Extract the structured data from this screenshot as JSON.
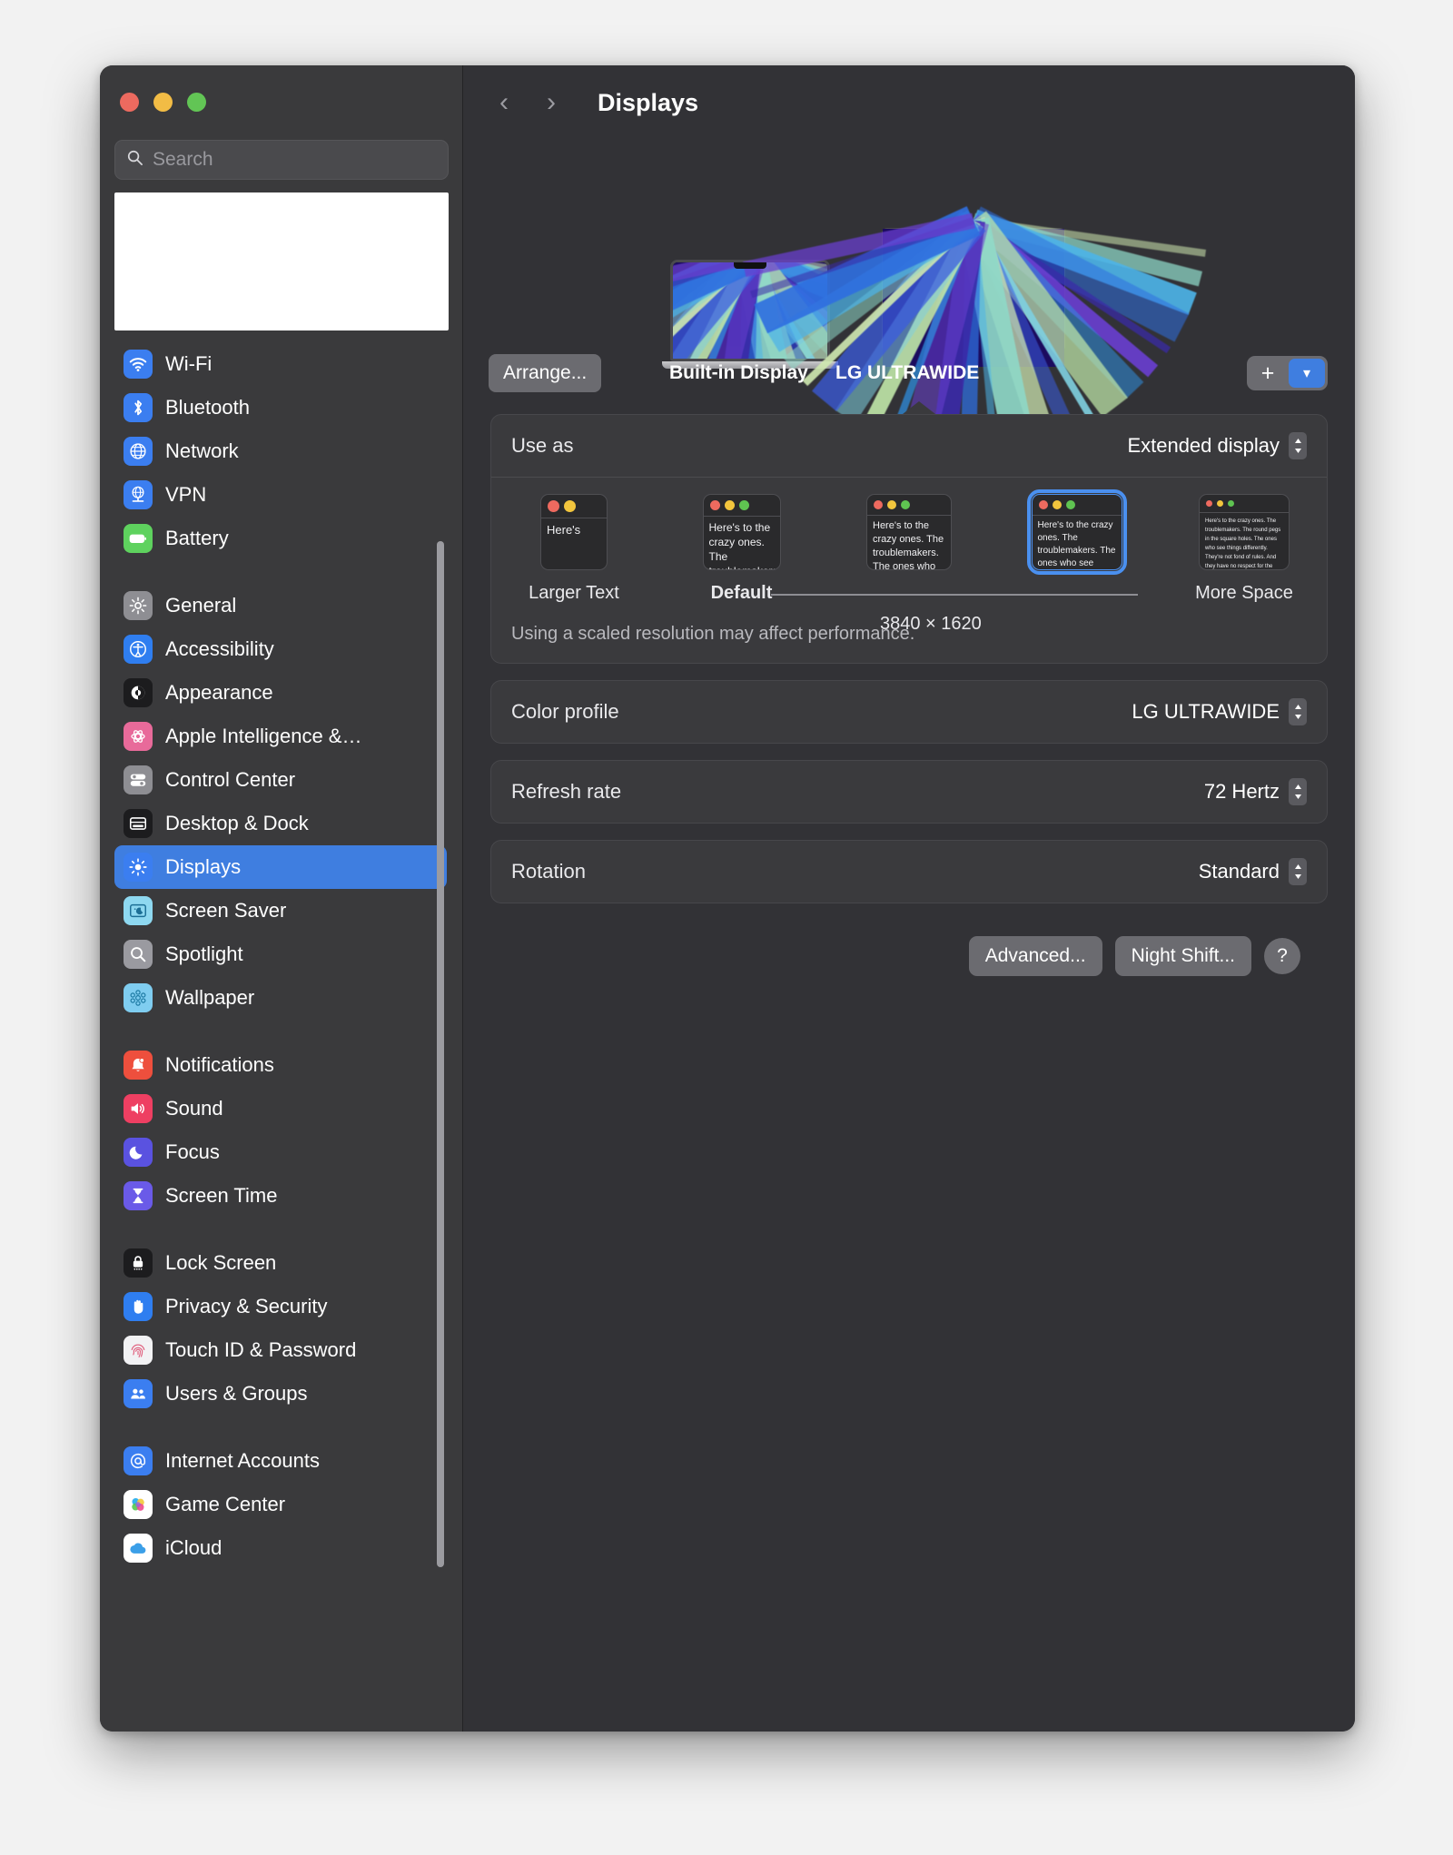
{
  "window": {
    "traffic_lights": [
      "close",
      "minimize",
      "zoom"
    ],
    "colors": {
      "close": "#ec6a5f",
      "minimize": "#f2bc45",
      "zoom": "#62c555",
      "accent": "#3f7ee0",
      "selection_ring": "#4a90f0"
    }
  },
  "sidebar": {
    "search": {
      "placeholder": "Search",
      "value": ""
    },
    "groups": [
      {
        "items": [
          {
            "label": "Wi-Fi",
            "icon": "wifi-icon",
            "icon_bg": "#3b7ef0",
            "selected": false
          },
          {
            "label": "Bluetooth",
            "icon": "bluetooth-icon",
            "icon_bg": "#3b7ef0",
            "selected": false
          },
          {
            "label": "Network",
            "icon": "globe-icon",
            "icon_bg": "#3b7ef0",
            "selected": false
          },
          {
            "label": "VPN",
            "icon": "vpn-globe-icon",
            "icon_bg": "#3b7ef0",
            "selected": false
          },
          {
            "label": "Battery",
            "icon": "battery-icon",
            "icon_bg": "#5ed25e",
            "selected": false
          }
        ]
      },
      {
        "items": [
          {
            "label": "General",
            "icon": "gear-icon",
            "icon_bg": "#8e8e93",
            "selected": false
          },
          {
            "label": "Accessibility",
            "icon": "accessibility-icon",
            "icon_bg": "#2f7ef0",
            "selected": false
          },
          {
            "label": "Appearance",
            "icon": "appearance-contrast-icon",
            "icon_bg": "#1c1c1e",
            "selected": false
          },
          {
            "label": "Apple Intelligence &…",
            "icon": "apple-intelligence-icon",
            "icon_bg": "#e86a9a",
            "selected": false
          },
          {
            "label": "Control Center",
            "icon": "control-center-icon",
            "icon_bg": "#8e8e93",
            "selected": false
          },
          {
            "label": "Desktop & Dock",
            "icon": "desktop-dock-icon",
            "icon_bg": "#1c1c1e",
            "selected": false
          },
          {
            "label": "Displays",
            "icon": "brightness-icon",
            "icon_bg": "#3b7ef0",
            "selected": true
          },
          {
            "label": "Screen Saver",
            "icon": "screen-saver-icon",
            "icon_bg": "#8ed8f0",
            "selected": false
          },
          {
            "label": "Spotlight",
            "icon": "search-icon",
            "icon_bg": "#9a9aa0",
            "selected": false
          },
          {
            "label": "Wallpaper",
            "icon": "wallpaper-icon",
            "icon_bg": "#7fcdf0",
            "selected": false
          }
        ]
      },
      {
        "items": [
          {
            "label": "Notifications",
            "icon": "bell-icon",
            "icon_bg": "#ee4f3d",
            "selected": false
          },
          {
            "label": "Sound",
            "icon": "speaker-icon",
            "icon_bg": "#ee3f62",
            "selected": false
          },
          {
            "label": "Focus",
            "icon": "moon-icon",
            "icon_bg": "#5a52e0",
            "selected": false
          },
          {
            "label": "Screen Time",
            "icon": "hourglass-icon",
            "icon_bg": "#6a5ae8",
            "selected": false
          }
        ]
      },
      {
        "items": [
          {
            "label": "Lock Screen",
            "icon": "lock-icon",
            "icon_bg": "#1c1c1e",
            "selected": false
          },
          {
            "label": "Privacy & Security",
            "icon": "hand-icon",
            "icon_bg": "#2f7ef0",
            "selected": false
          },
          {
            "label": "Touch ID & Password",
            "icon": "fingerprint-icon",
            "icon_bg": "#f2f2f4",
            "selected": false
          },
          {
            "label": "Users & Groups",
            "icon": "users-icon",
            "icon_bg": "#3b7ef0",
            "selected": false
          }
        ]
      },
      {
        "items": [
          {
            "label": "Internet Accounts",
            "icon": "at-sign-icon",
            "icon_bg": "#3b7ef0",
            "selected": false
          },
          {
            "label": "Game Center",
            "icon": "game-center-icon",
            "icon_bg": "#ffffff",
            "selected": false
          },
          {
            "label": "iCloud",
            "icon": "icloud-icon",
            "icon_bg": "#ffffff",
            "selected": false
          }
        ]
      }
    ]
  },
  "toolbar": {
    "back_icon": "chevron-left-icon",
    "forward_icon": "chevron-right-icon",
    "title": "Displays"
  },
  "displays": {
    "arrange_label": "Arrange...",
    "built_in_label": "Built-in Display",
    "external_label": "LG ULTRAWIDE",
    "add_label": "+",
    "add_caret_icon": "chevron-down-icon"
  },
  "use_as": {
    "label": "Use as",
    "value": "Extended display",
    "stepper_icon": "up-down-chevrons-icon"
  },
  "resolutions": {
    "options": [
      {
        "caption": "Larger Text",
        "bold": false,
        "selected": false,
        "thumb_w": 74,
        "dots": 2,
        "dot_size": 13,
        "text": "Here's",
        "font_size": 13
      },
      {
        "caption": "Default",
        "bold": true,
        "selected": false,
        "thumb_w": 86,
        "dots": 3,
        "dot_size": 11,
        "text": "Here's to the crazy ones. The troublemakers.",
        "font_size": 12
      },
      {
        "caption": "",
        "bold": false,
        "selected": false,
        "thumb_w": 94,
        "dots": 3,
        "dot_size": 10,
        "text": "Here's to the crazy ones. The troublemakers. The ones who see things differently.",
        "font_size": 11
      },
      {
        "caption": "",
        "bold": false,
        "selected": true,
        "thumb_w": 100,
        "dots": 3,
        "dot_size": 10,
        "text": "Here's to the crazy ones. The troublemakers. The ones who see things differently. And they have no respect for the status quo.",
        "font_size": 10
      },
      {
        "caption": "More Space",
        "bold": false,
        "selected": false,
        "thumb_w": 100,
        "dots": 3,
        "dot_size": 7,
        "text": "Here's to the crazy ones. The troublemakers. The round pegs in the square holes. The ones who see things differently. They're not fond of rules. And they have no respect for the status quo. You can quote them, disagree with them, glorify or vilify them. About the only thing you can't do is ignore them. Because they change things.",
        "font_size": 6
      }
    ],
    "selected_dimensions": "3840 × 1620",
    "note": "Using a scaled resolution may affect performance."
  },
  "settings_rows": [
    {
      "label": "Color profile",
      "value": "LG ULTRAWIDE"
    },
    {
      "label": "Refresh rate",
      "value": "72 Hertz"
    },
    {
      "label": "Rotation",
      "value": "Standard"
    }
  ],
  "footer_buttons": {
    "advanced": "Advanced...",
    "night_shift": "Night Shift...",
    "help": "?"
  }
}
